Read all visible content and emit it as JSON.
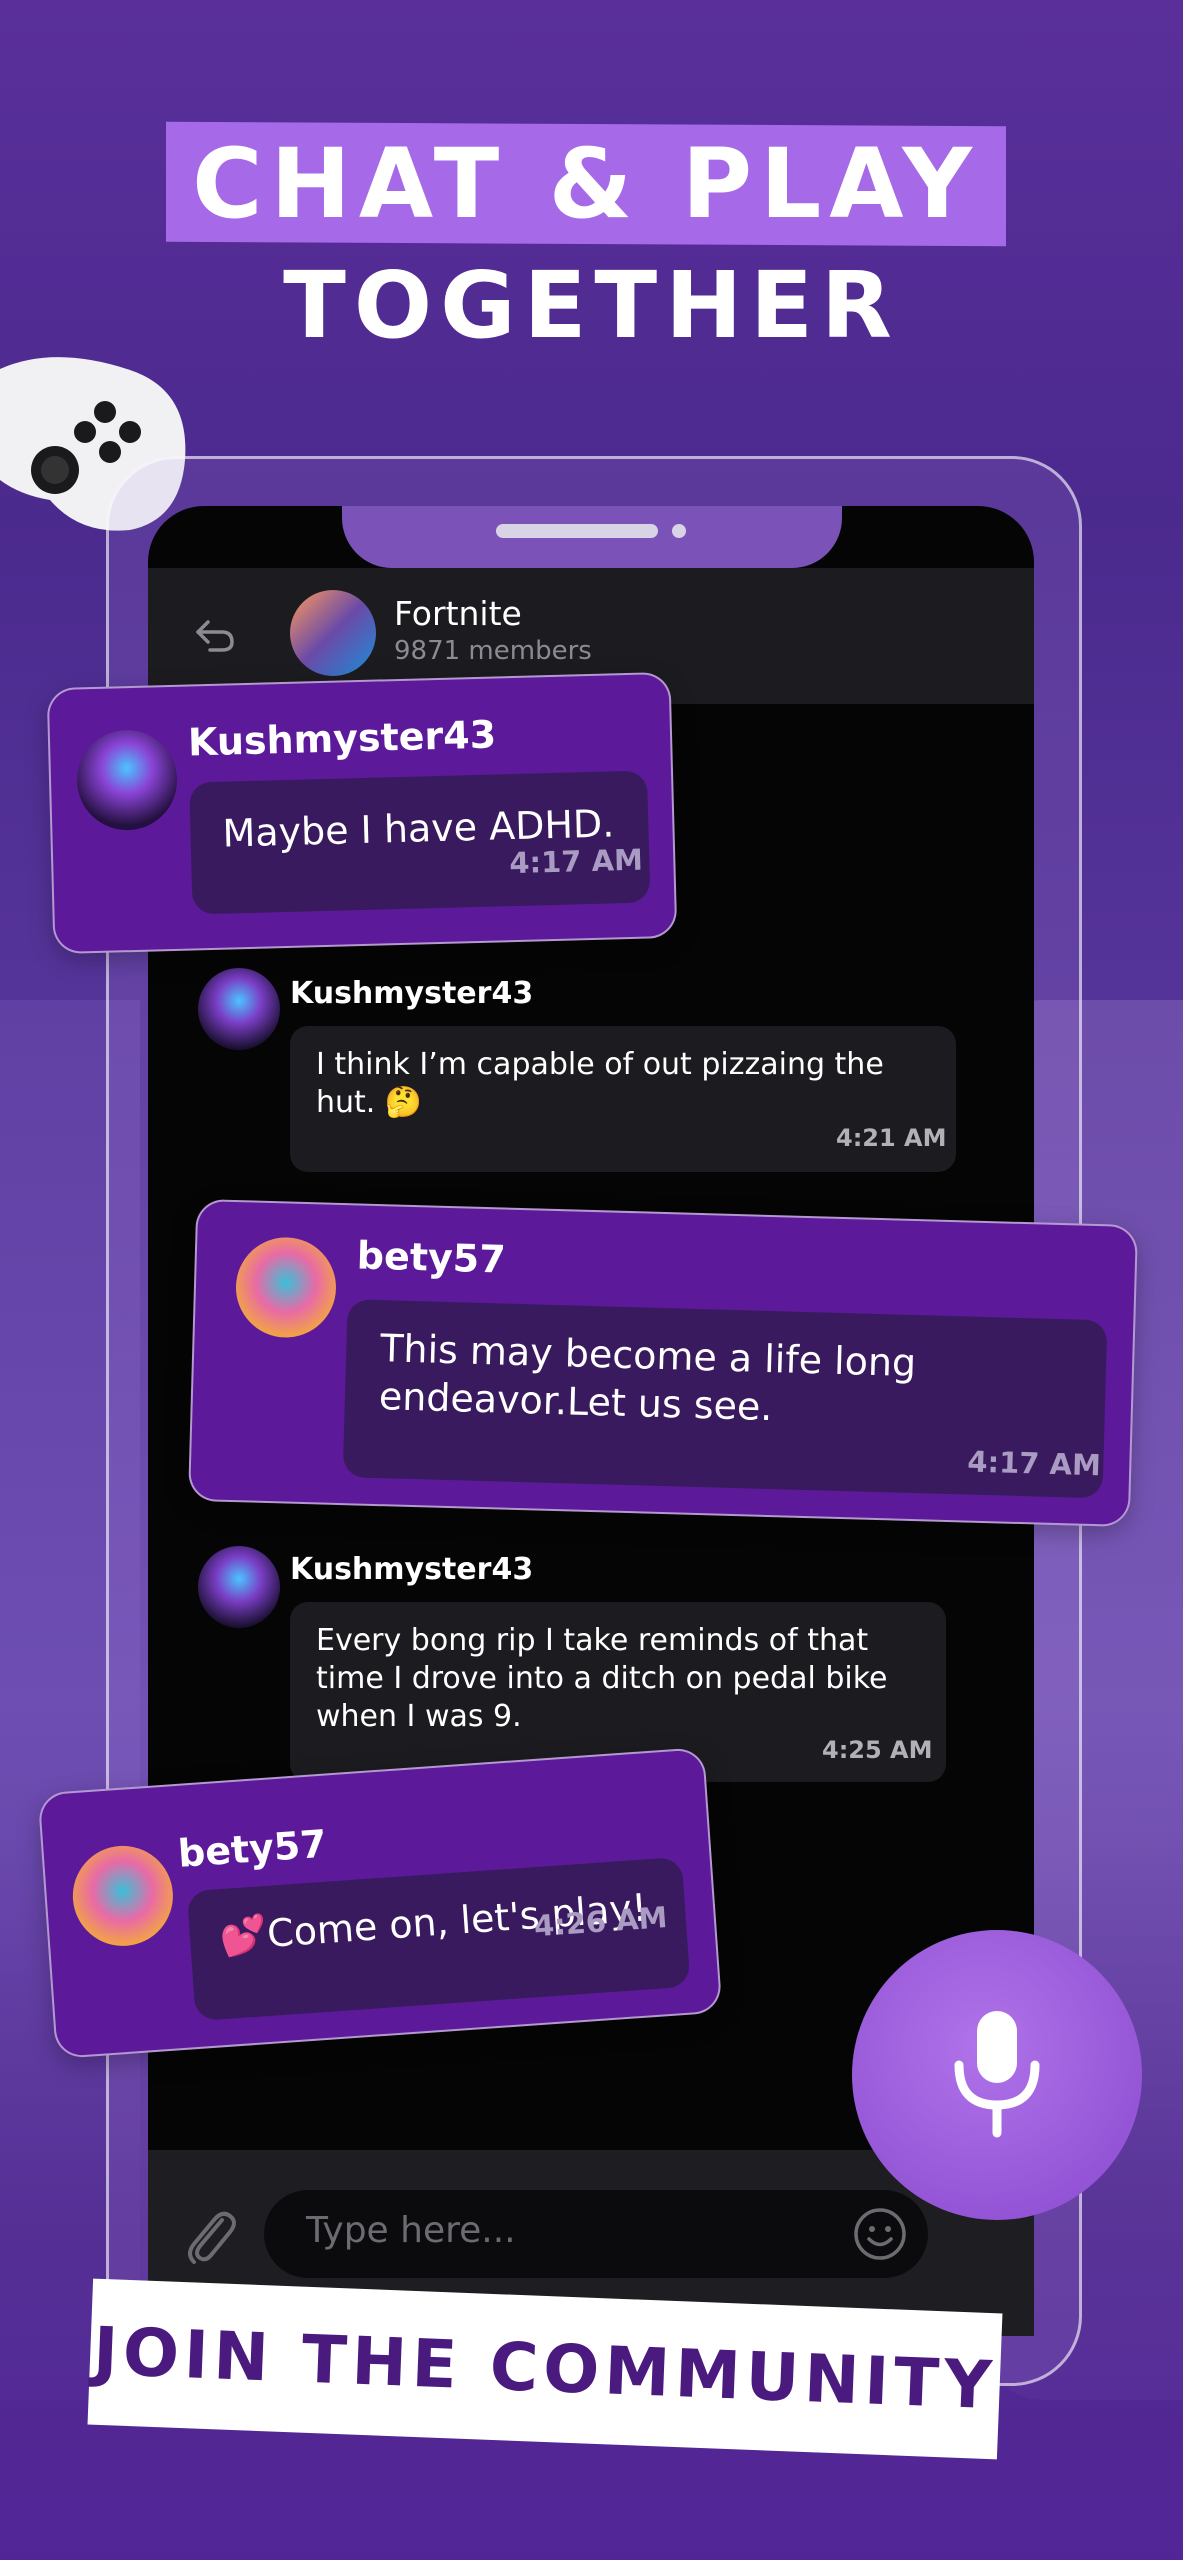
{
  "promo": {
    "headline_line1": "CHAT & PLAY",
    "headline_line2": "TOGETHER",
    "footer_cta": "JOIN THE COMMUNITY"
  },
  "chat": {
    "group_name": "Fortnite",
    "member_count": "9871 members",
    "messages": [
      {
        "author": "Kushmyster43",
        "text": "Maybe I have ADHD.",
        "time": "4:17 AM"
      },
      {
        "author": "Kushmyster43",
        "text_line1": "I think I’m capable of out pizzaing the",
        "text_line2": "hut. 🤔",
        "time": "4:21 AM"
      },
      {
        "author": "bety57",
        "text_line1": "This may become a life long",
        "text_line2": "endeavor.Let us see.",
        "time": "4:17 AM"
      },
      {
        "author": "Kushmyster43",
        "text_line1": "Every bong rip I take reminds of that",
        "text_line2": "time I drove into a ditch on pedal bike",
        "text_line3": "when I was 9.",
        "time": "4:25 AM"
      },
      {
        "author": "bety57",
        "text": "💕Come on, let's play!",
        "time": "4:26 AM"
      }
    ],
    "input_placeholder": "Type here..."
  },
  "icons": {
    "back": "back-arrow-icon",
    "attach": "paperclip-icon",
    "emoji": "smiley-icon",
    "mic": "microphone-icon",
    "controller": "game-controller-icon"
  },
  "colors": {
    "background": "#5a2f9a",
    "accent": "#a66ae8",
    "card": "#5c1a9a",
    "card_inner": "#3a1a5e",
    "mic": "#9456d6"
  }
}
